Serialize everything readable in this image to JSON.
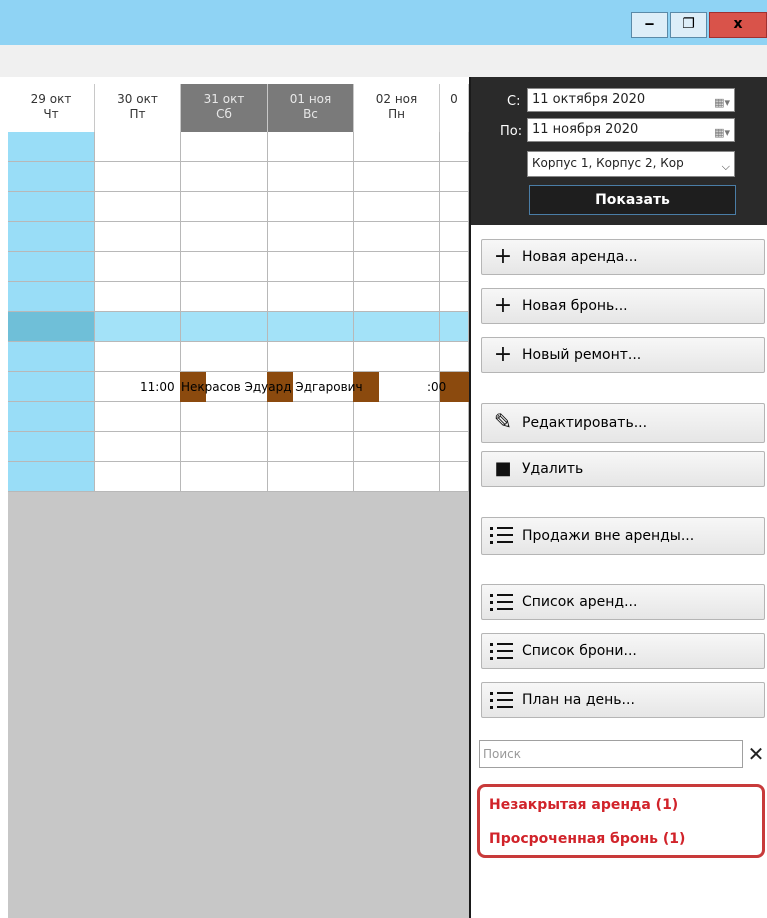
{
  "window": {
    "minimize_label": "‒",
    "restore_label": "❐",
    "close_label": "x"
  },
  "grid": {
    "columns": [
      {
        "date": "29 окт",
        "day": "Чт",
        "weekend": false
      },
      {
        "date": "30 окт",
        "day": "Пт",
        "weekend": false
      },
      {
        "date": "31 окт",
        "day": "Сб",
        "weekend": true
      },
      {
        "date": "01 ноя",
        "day": "Вс",
        "weekend": true
      },
      {
        "date": "02 ноя",
        "day": "Пн",
        "weekend": false
      },
      {
        "date": "0",
        "day": "",
        "weekend": false
      }
    ],
    "row_count": 12,
    "selected_row": 6,
    "booking": {
      "start_time": "11:00",
      "guest": "Некрасов Эдуард Эдгарович",
      "end_time": ":00"
    }
  },
  "filter": {
    "from_label": "С:",
    "from_value": "11 октября  2020",
    "to_label": "По:",
    "to_value": "11  ноября  2020",
    "buildings_value": "Корпус 1, Корпус 2, Кор",
    "show_label": "Показать"
  },
  "actions": {
    "new_rental": "Новая аренда...",
    "new_booking": "Новая бронь...",
    "new_repair": "Новый ремонт...",
    "edit": "Редактировать...",
    "delete": "Удалить",
    "sales_outside": "Продажи вне аренды...",
    "rental_list": "Список аренд...",
    "booking_list": "Список брони...",
    "day_plan": "План на день..."
  },
  "search": {
    "placeholder": "Поиск",
    "clear_label": "✕"
  },
  "alerts": {
    "unclosed_rental": "Незакрытая аренда (1)",
    "overdue_booking": "Просроченная бронь (1)"
  }
}
